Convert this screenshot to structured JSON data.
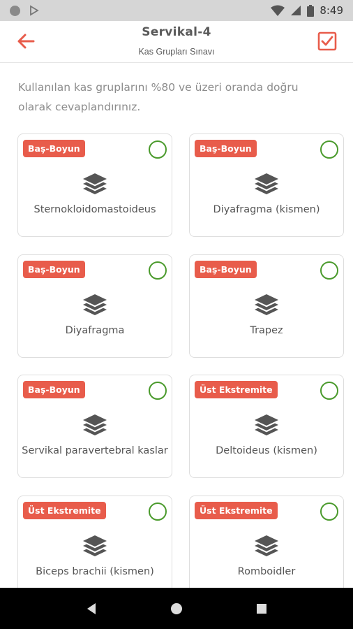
{
  "status_bar": {
    "time": "8:49"
  },
  "header": {
    "title": "Servikal-4",
    "subtitle": "Kas Grupları Sınavı"
  },
  "instructions": "Kullanılan kas gruplarını %80 ve üzeri oranda doğru olarak cevaplandırınız.",
  "colors": {
    "accent": "#e85c4b",
    "radio": "#4a9a2c",
    "text": "#555555"
  },
  "cards": [
    {
      "tag": "Baş-Boyun",
      "label": "Sternokloidomastoideus"
    },
    {
      "tag": "Baş-Boyun",
      "label": "Diyafragma (kismen)"
    },
    {
      "tag": "Baş-Boyun",
      "label": "Diyafragma"
    },
    {
      "tag": "Baş-Boyun",
      "label": "Trapez"
    },
    {
      "tag": "Baş-Boyun",
      "label": "Servikal paravertebral kaslar"
    },
    {
      "tag": "Üst Ekstremite",
      "label": "Deltoideus (kismen)"
    },
    {
      "tag": "Üst Ekstremite",
      "label": "Biceps brachii (kismen)"
    },
    {
      "tag": "Üst Ekstremite",
      "label": "Romboidler"
    }
  ]
}
